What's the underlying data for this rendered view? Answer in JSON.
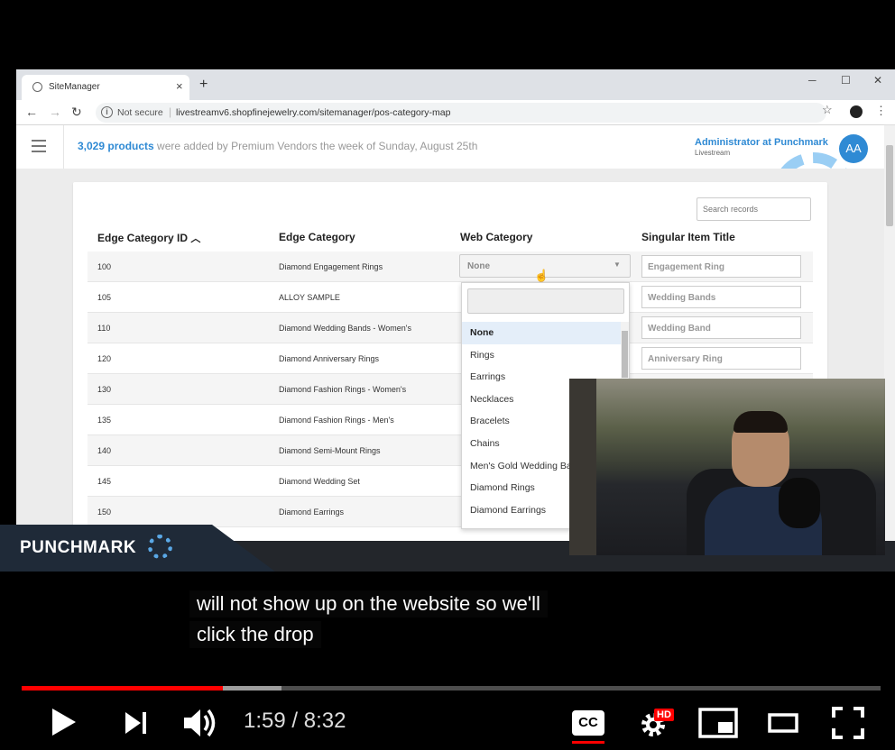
{
  "browser": {
    "tab_title": "SiteManager",
    "tab_close": "×",
    "new_tab": "+",
    "win_minimize": "─",
    "win_maximize": "☐",
    "win_close": "✕",
    "not_secure": "Not secure",
    "url": "livestreamv6.shopfinejewelry.com/sitemanager/pos-category-map"
  },
  "header": {
    "product_count": "3,029 products",
    "notice_rest": " were added by Premium Vendors the week of Sunday, August 25th",
    "admin_name": "Administrator at Punchmark",
    "admin_sub": "Livestream",
    "avatar_initials": "AA"
  },
  "table": {
    "search_placeholder": "Search records",
    "headers": [
      "Edge Category ID",
      "Edge Category",
      "Web Category",
      "Singular Item Title"
    ],
    "rows": [
      {
        "id": "100",
        "category": "Diamond Engagement Rings",
        "web": "None",
        "title": "Engagement Ring"
      },
      {
        "id": "105",
        "category": "ALLOY SAMPLE",
        "title": "Wedding Bands"
      },
      {
        "id": "110",
        "category": "Diamond Wedding Bands - Women's",
        "title": "Wedding Band"
      },
      {
        "id": "120",
        "category": "Diamond Anniversary Rings",
        "title": "Anniversary Ring"
      },
      {
        "id": "130",
        "category": "Diamond Fashion Rings - Women's"
      },
      {
        "id": "135",
        "category": "Diamond Fashion Rings - Men's"
      },
      {
        "id": "140",
        "category": "Diamond Semi-Mount Rings"
      },
      {
        "id": "145",
        "category": "Diamond Wedding Set"
      },
      {
        "id": "150",
        "category": "Diamond Earrings"
      }
    ]
  },
  "dropdown": {
    "options": [
      "None",
      "Rings",
      "Earrings",
      "Necklaces",
      "Bracelets",
      "Chains",
      "Men's Gold Wedding Bands",
      "Diamond Rings",
      "Diamond Earrings"
    ],
    "selected": "None"
  },
  "branding": {
    "text": "PUNCHMARK"
  },
  "captions": [
    "will not show up on the website so we'll",
    "click the drop"
  ],
  "player": {
    "current_time": "1:59",
    "duration": "8:32",
    "time_display": "1:59 / 8:32",
    "played_fraction": 0.234,
    "buffered_fraction": 0.302,
    "cc_label": "CC",
    "hd_badge": "HD",
    "played_color": "#ff0000"
  }
}
